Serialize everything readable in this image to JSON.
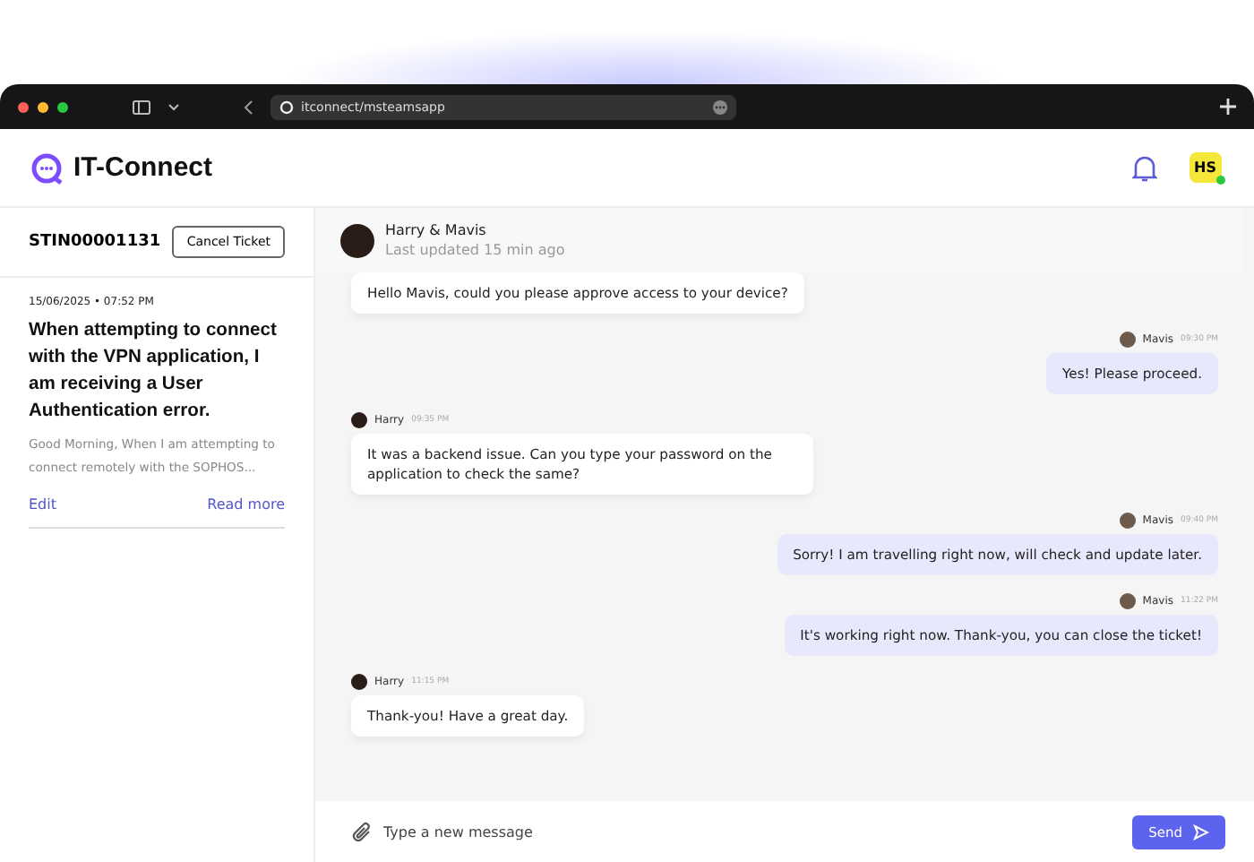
{
  "browser": {
    "url": "itconnect/msteamsapp"
  },
  "header": {
    "app_name": "IT-Connect",
    "user_initials": "HS",
    "online": true
  },
  "ticket": {
    "id": "STIN00001131",
    "cancel_label": "Cancel Ticket",
    "date": "15/06/2025 • 07:52 PM",
    "title": "When attempting to connect with the VPN application, I am receiving a User Authentication error.",
    "preview": "Good Morning,  When I am attempting to connect remotely with the SOPHOS...",
    "edit_label": "Edit",
    "read_more_label": "Read more"
  },
  "chat": {
    "title": "Harry & Mavis",
    "subtitle": "Last updated 15 min ago",
    "messages": [
      {
        "kind": "received",
        "text": "Hello Mavis, could you please approve access to your device?"
      },
      {
        "kind": "sent",
        "sender": "Mavis",
        "time": "09:30 PM",
        "text": "Yes! Please proceed."
      },
      {
        "kind": "received",
        "sender": "Harry",
        "time": "09:35 PM",
        "text": "It was a backend issue. Can you type your password on the application to check the same?"
      },
      {
        "kind": "sent",
        "sender": "Mavis",
        "time": "09:40 PM",
        "text": "Sorry! I am travelling right now, will check and update later."
      },
      {
        "kind": "sent",
        "sender": "Mavis",
        "time": "11:22 PM",
        "text": "It's working right now. Thank-you, you can close the ticket!"
      },
      {
        "kind": "received",
        "sender": "Harry",
        "time": "11:15 PM",
        "text": "Thank-you! Have a great day."
      }
    ]
  },
  "composer": {
    "placeholder": "Type a new message",
    "send_label": "Send"
  }
}
